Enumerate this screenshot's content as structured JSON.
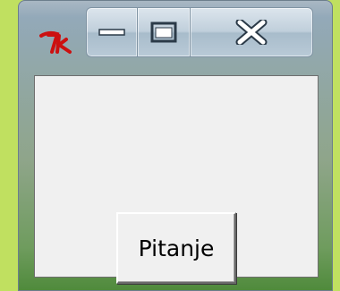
{
  "window": {
    "icon": "tk-feather-icon",
    "caption_buttons": {
      "minimize": "minimize-icon",
      "maximize": "maximize-icon",
      "close": "close-icon"
    }
  },
  "content": {
    "button_label": "Pitanje"
  },
  "colors": {
    "desktop": "#c0e060",
    "client_background": "#f0f0f0",
    "tk_icon": "#cc1010"
  }
}
